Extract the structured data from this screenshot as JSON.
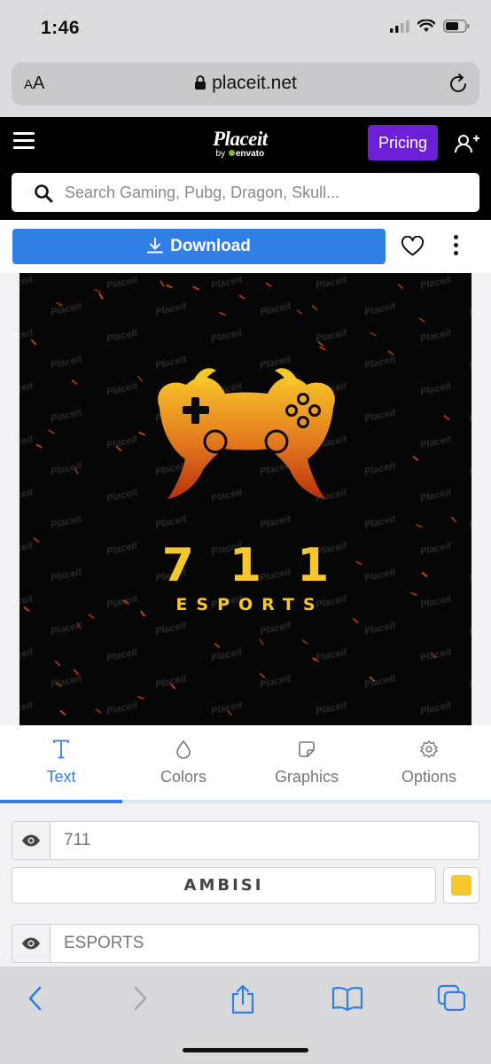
{
  "status_bar": {
    "time": "1:46"
  },
  "browser": {
    "text_size_label_small": "A",
    "text_size_label_large": "A",
    "url": "placeit.net"
  },
  "site_header": {
    "logo_text": "Placeit",
    "logo_by": "by",
    "logo_brand": "envato",
    "pricing_label": "Pricing",
    "search_placeholder": "Search Gaming, Pubg, Dragon, Skull..."
  },
  "actions": {
    "download_label": "Download"
  },
  "preview": {
    "watermark": "Placeit",
    "logo_number": "711",
    "logo_word": "ESPORTS"
  },
  "tabs": [
    {
      "label": "Text",
      "icon": "text-icon",
      "active": true
    },
    {
      "label": "Colors",
      "icon": "drop-icon",
      "active": false
    },
    {
      "label": "Graphics",
      "icon": "sticker-icon",
      "active": false
    },
    {
      "label": "Options",
      "icon": "gear-icon",
      "active": false
    }
  ],
  "editor": {
    "field1_value": "711",
    "font_name": "AMBISI",
    "text_color": "#f6c72a",
    "field2_value": "ESPORTS"
  },
  "colors": {
    "accent_blue": "#2f7fe6",
    "pricing_purple": "#6d1fd8",
    "logo_gold": "#f6c72a"
  }
}
